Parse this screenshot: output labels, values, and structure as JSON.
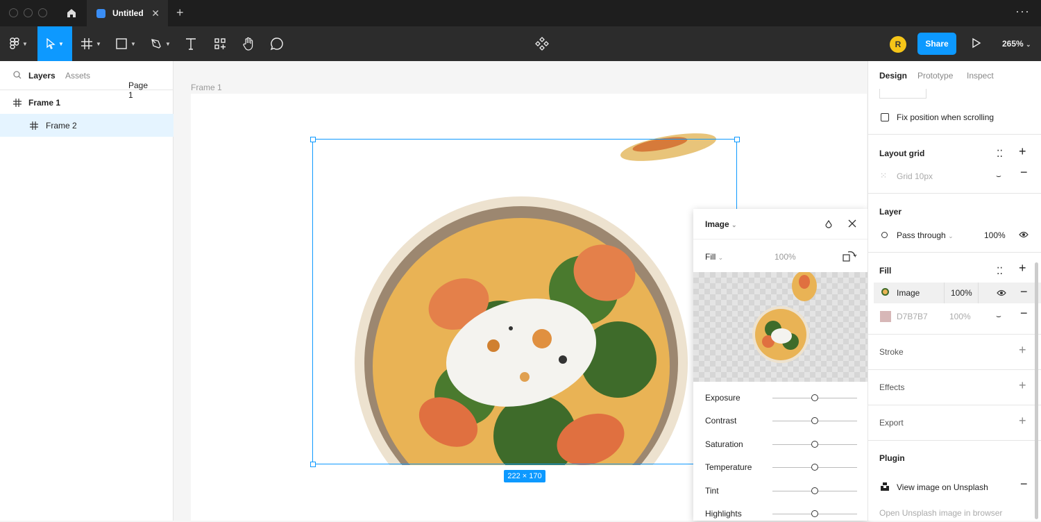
{
  "tab": {
    "title": "Untitled"
  },
  "toolbar": {
    "avatar_initial": "R",
    "share_label": "Share",
    "zoom": "265%"
  },
  "left_panel": {
    "tabs": [
      "Layers",
      "Assets"
    ],
    "page": "Page 1",
    "layers": [
      {
        "name": "Frame 1",
        "selected": false
      },
      {
        "name": "Frame 2",
        "selected": true
      }
    ]
  },
  "canvas": {
    "frame_label": "Frame 1",
    "dimension_label": "222 × 170"
  },
  "image_popover": {
    "title": "Image",
    "fill_mode": "Fill",
    "opacity": "100%",
    "adjustments": [
      {
        "label": "Exposure",
        "value": 0.5
      },
      {
        "label": "Contrast",
        "value": 0.5
      },
      {
        "label": "Saturation",
        "value": 0.5
      },
      {
        "label": "Temperature",
        "value": 0.5
      },
      {
        "label": "Tint",
        "value": 0.5
      },
      {
        "label": "Highlights",
        "value": 0.5
      }
    ]
  },
  "right_panel": {
    "tabs": [
      "Design",
      "Prototype",
      "Inspect"
    ],
    "fix_position_label": "Fix position when scrolling",
    "layout_grid": {
      "title": "Layout grid",
      "item": "Grid 10px"
    },
    "layer": {
      "title": "Layer",
      "blend": "Pass through",
      "opacity": "100%"
    },
    "fill": {
      "title": "Fill",
      "items": [
        {
          "name": "Image",
          "opacity": "100%"
        },
        {
          "name": "D7B7B7",
          "opacity": "100%",
          "color": "#D7B7B7"
        }
      ]
    },
    "stroke_title": "Stroke",
    "effects_title": "Effects",
    "export_title": "Export",
    "plugin": {
      "title": "Plugin",
      "item": "View image on Unsplash",
      "link": "Open Unsplash image in browser"
    }
  },
  "colors": {
    "accent": "#0d99ff",
    "toolbar": "#2c2c2c",
    "titlebar": "#1e1e1e"
  }
}
